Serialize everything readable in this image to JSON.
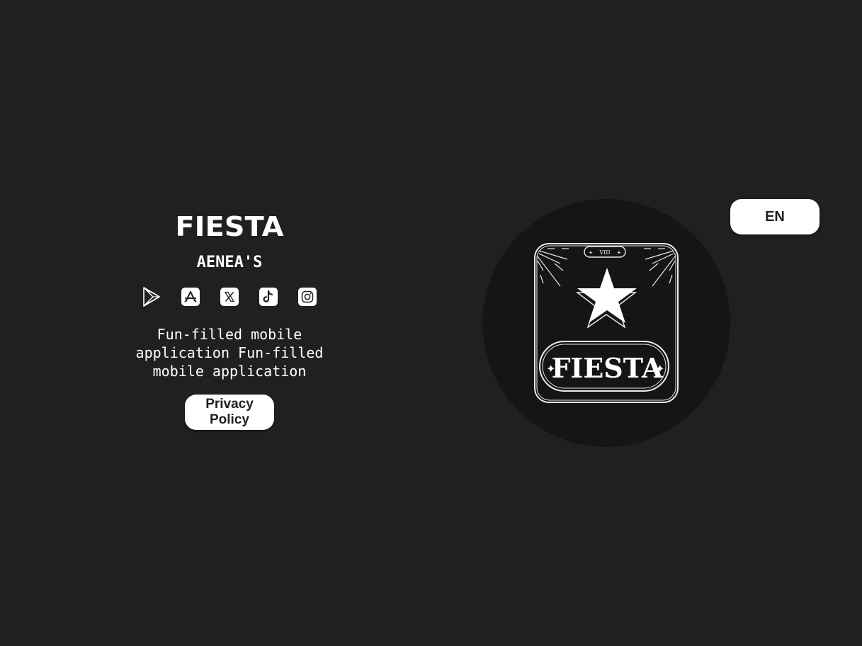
{
  "brand": {
    "wordmark": "FIESTA",
    "studio": "AENEA'S"
  },
  "store_links": [
    {
      "name": "google-play",
      "icon": "google-play-icon"
    },
    {
      "name": "app-store",
      "icon": "app-store-icon"
    },
    {
      "name": "x",
      "icon": "x-icon"
    },
    {
      "name": "tiktok",
      "icon": "tiktok-icon"
    },
    {
      "name": "instagram",
      "icon": "instagram-icon"
    }
  ],
  "tagline": "Fun-filled mobile application Fun-filled mobile application",
  "privacy_button": "Privacy Policy",
  "language_button": "EN",
  "app_icon": {
    "badge_text": "VIII",
    "title": "FIESTA"
  },
  "colors": {
    "background": "#202020",
    "circle": "#151515",
    "foreground": "#ffffff"
  }
}
